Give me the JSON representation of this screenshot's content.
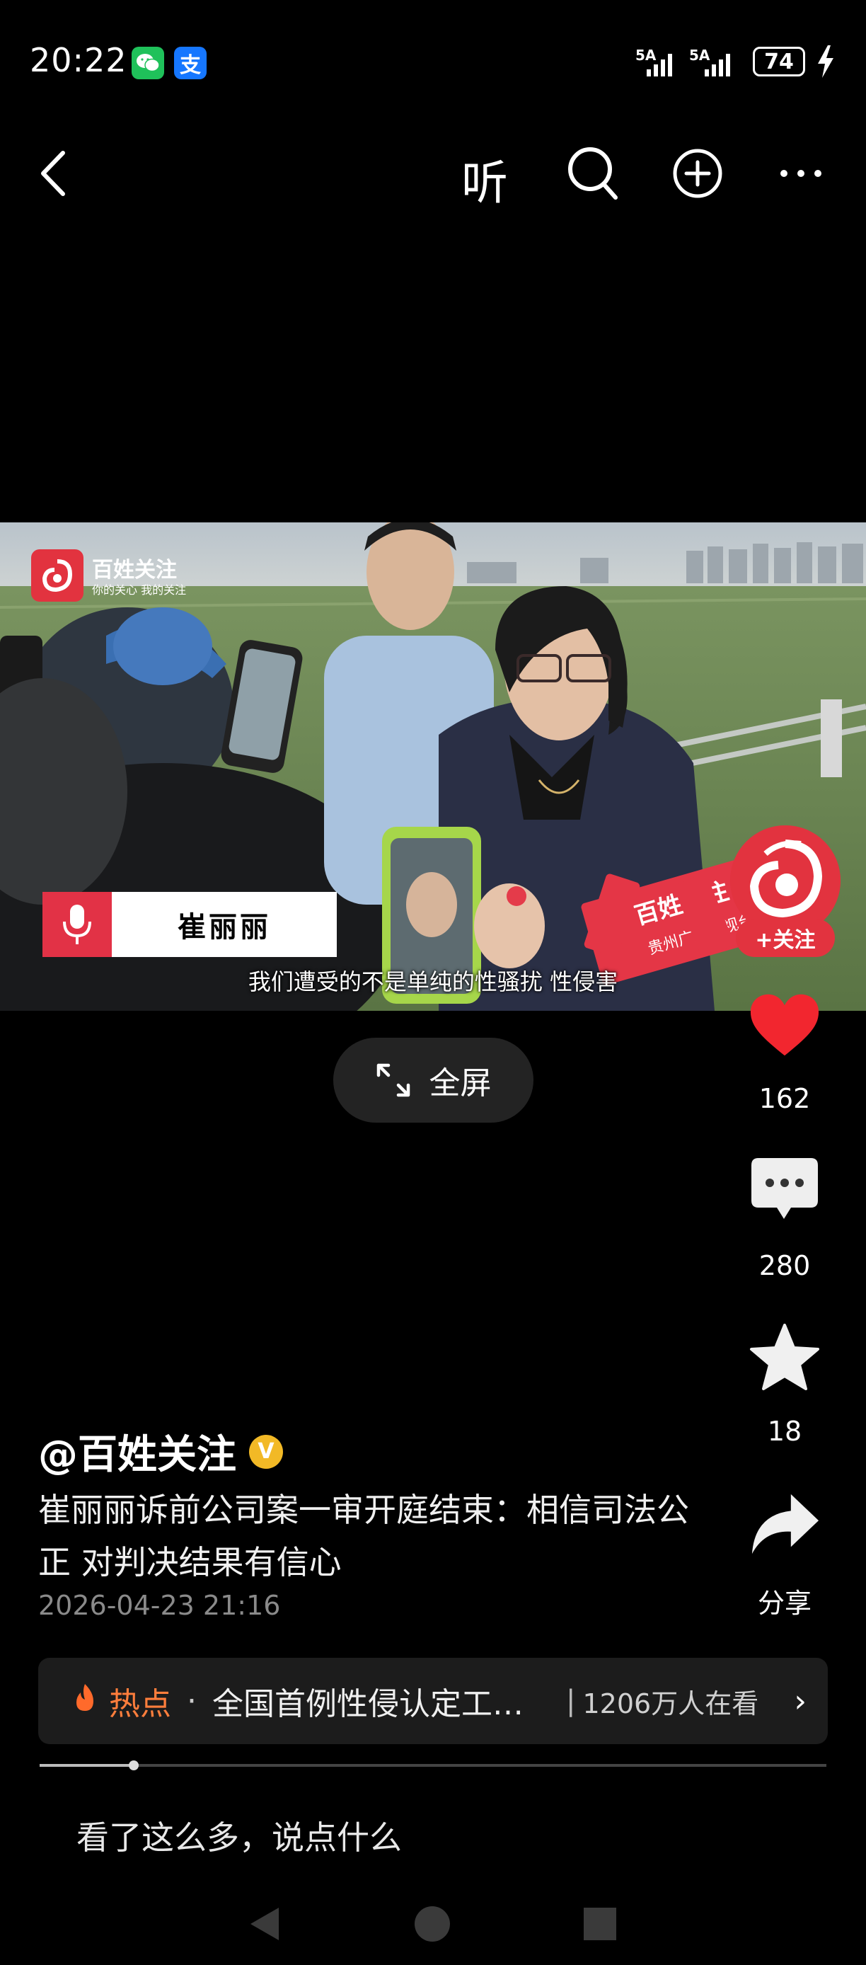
{
  "status_bar": {
    "time": "20:22",
    "apps": [
      {
        "icon": "wechat-icon",
        "glyph": "✆",
        "color": "#1fc15a"
      },
      {
        "icon": "alipay-icon",
        "glyph": "支",
        "color": "#1677ff"
      }
    ],
    "signal_1": "5A",
    "signal_2": "5A",
    "battery": "74"
  },
  "top_nav": {
    "back_icon": "back-arrow-icon",
    "listen_label": "听",
    "search_icon": "search-icon",
    "add_icon": "add-circle-icon",
    "more_icon": "more-icon"
  },
  "video": {
    "watermark_title": "百姓关注",
    "watermark_slogan": "你的关心 我的关注",
    "speaker_name": "崔丽丽",
    "subtitle": "我们遭受的不是单纯的性骚扰 性侵害",
    "mic_flag": "百姓关注",
    "mic_flag_sub": "贵州广播电视台"
  },
  "fullscreen": {
    "label": "全屏"
  },
  "sidebar": {
    "follow_label": "+关注",
    "likes": "162",
    "comments": "280",
    "favorites": "18",
    "share_label": "分享"
  },
  "post": {
    "author": "@百姓关注",
    "verified": "V",
    "description": "崔丽丽诉前公司案一审开庭结束：相信司法公正 对判决结果有信心",
    "date": "2026-04-23 21:16"
  },
  "hot": {
    "label": "热点",
    "dot": "·",
    "title": "全国首例性侵认定工…",
    "separator": "|",
    "viewers": "1206万人在看",
    "arrow": "›"
  },
  "progress": {
    "fraction": 0.12
  },
  "comment_input": {
    "placeholder": "看了这么多，说点什么"
  },
  "colors": {
    "accent": "#e2333f",
    "hot": "#ff7e3c",
    "background": "#000000"
  }
}
